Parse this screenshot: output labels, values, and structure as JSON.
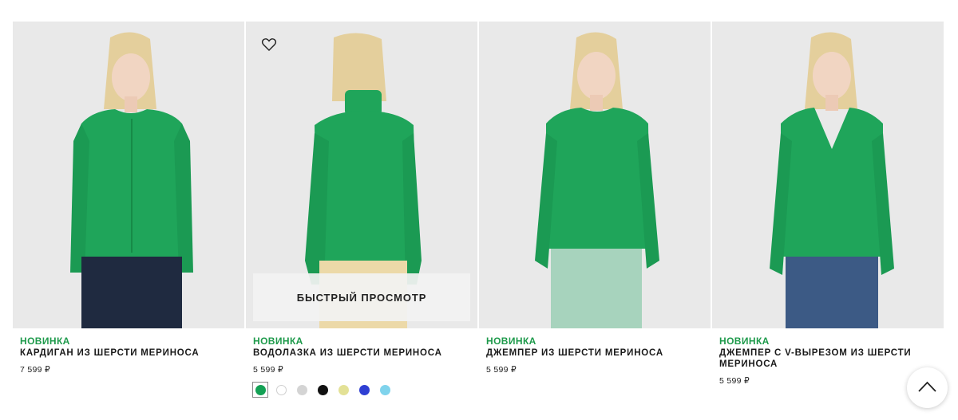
{
  "colors": {
    "accent_green": "#1e9a4b",
    "sweater_green": "#1fa55a",
    "badge_green": "#1e9a4b"
  },
  "products": [
    {
      "badge": "НОВИНКА",
      "name": "КАРДИГАН ИЗ ШЕРСТИ МЕРИНОСА",
      "price": "7 599 ₽"
    },
    {
      "badge": "НОВИНКА",
      "name": "ВОДОЛАЗКА ИЗ ШЕРСТИ МЕРИНОСА",
      "price": "5 599 ₽",
      "quick_view": "БЫСТРЫЙ ПРОСМОТР",
      "wishlist_icon": "heart-outline-icon",
      "swatches": [
        {
          "name": "green",
          "color": "#14a155",
          "selected": true
        },
        {
          "name": "white",
          "color": "#ffffff"
        },
        {
          "name": "light-grey",
          "color": "#d4d4d4"
        },
        {
          "name": "black",
          "color": "#111111"
        },
        {
          "name": "yellow",
          "color": "#e3e196"
        },
        {
          "name": "blue",
          "color": "#2f3fd3"
        },
        {
          "name": "light-blue",
          "color": "#7fd3ec"
        }
      ]
    },
    {
      "badge": "НОВИНКА",
      "name": "ДЖЕМПЕР ИЗ ШЕРСТИ МЕРИНОСА",
      "price": "5 599 ₽"
    },
    {
      "badge": "НОВИНКА",
      "name": "ДЖЕМПЕР С V-ВЫРЕЗОМ ИЗ ШЕРСТИ МЕРИНОСА",
      "price": "5 599 ₽"
    }
  ],
  "back_to_top_icon": "chevron-up-icon"
}
